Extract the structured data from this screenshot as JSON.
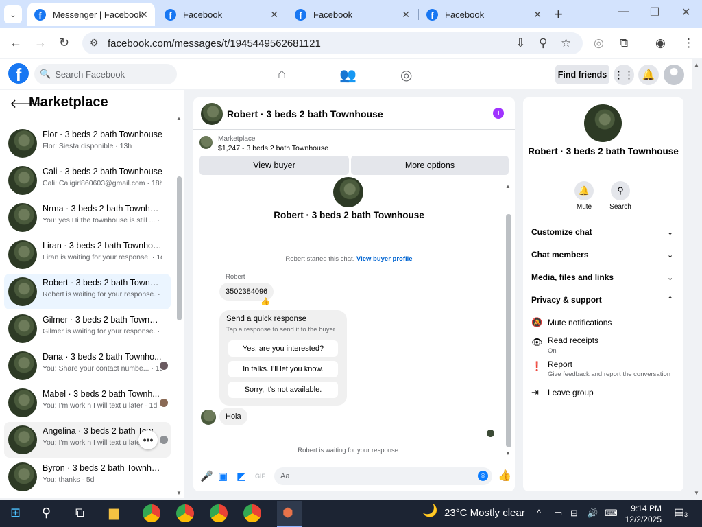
{
  "browser": {
    "tabs": [
      {
        "title": "Messenger | Facebook",
        "active": true
      },
      {
        "title": "Facebook",
        "active": false
      },
      {
        "title": "Facebook",
        "active": false
      },
      {
        "title": "Facebook",
        "active": false
      }
    ],
    "url": "facebook.com/messages/t/1945449562681121"
  },
  "fb": {
    "logo": "f",
    "search_placeholder": "Search Facebook",
    "find_friends": "Find friends"
  },
  "sidebar": {
    "title": "Marketplace",
    "conversations": [
      {
        "name": "Flor · 3 beds 2 bath Townhouse",
        "preview": "Flor: Siesta disponible · 13h"
      },
      {
        "name": "Cali · 3 beds 2 bath Townhouse",
        "preview": "Cali: Caligirl860603@gmail.com · 18h"
      },
      {
        "name": "Nrma · 3 beds 2 bath Townhouse",
        "preview": "You: yes Hi the townhouse is still ... · 23h"
      },
      {
        "name": "Liran · 3 beds 2 bath Townhouse",
        "preview": "Liran is waiting for your response. · 1d"
      },
      {
        "name": "Robert · 3 beds 2 bath Townho...",
        "preview": "Robert is waiting for your response. · 1d"
      },
      {
        "name": "Gilmer · 3 beds 2 bath Townhou...",
        "preview": "Gilmer is waiting for your response. · 1d"
      },
      {
        "name": "Dana · 3 beds 2 bath Townho...",
        "preview": "You: Share your contact numbe... · 1d"
      },
      {
        "name": "Mabel · 3 beds 2 bath Townh...",
        "preview": "You: I'm work n I will text u later · 1d"
      },
      {
        "name": "Angelina · 3 beds 2 bath Tow",
        "preview": "You: I'm work n I will text u later"
      },
      {
        "name": "Byron · 3 beds 2 bath Townhouse",
        "preview": "You: thanks · 5d"
      }
    ]
  },
  "chat": {
    "title": "Robert · 3 beds 2 bath Townhouse",
    "marketplace_label": "Marketplace",
    "listing": "$1,247 - 3 beds 2 bath Townhouse",
    "view_buyer": "View buyer",
    "more_options": "More options",
    "header_name": "Robert · 3 beds 2 bath Townhouse",
    "started_text": "Robert started this chat.",
    "view_profile": "View buyer profile",
    "sender": "Robert",
    "message1": "3502384096",
    "quick_title": "Send a quick response",
    "quick_sub": "Tap a response to send it to the buyer.",
    "quick_replies": [
      "Yes, are you interested?",
      "In talks. I'll let you know.",
      "Sorry, it's not available."
    ],
    "message2": "Hola",
    "waiting": "Robert is waiting for your response.",
    "composer_placeholder": "Aa",
    "gif_label": "GIF"
  },
  "info": {
    "name": "Robert · 3 beds 2 bath Townhouse",
    "mute": "Mute",
    "search": "Search",
    "sections": [
      "Customize chat",
      "Chat members",
      "Media, files and links",
      "Privacy & support"
    ],
    "mute_notifications": "Mute notifications",
    "read_receipts": "Read receipts",
    "read_receipts_state": "On",
    "report": "Report",
    "report_sub": "Give feedback and report the conversation",
    "leave_group": "Leave group"
  },
  "taskbar": {
    "weather": "23°C  Mostly clear",
    "time": "9:14 PM",
    "date": "12/2/2025",
    "notifications": "3"
  }
}
